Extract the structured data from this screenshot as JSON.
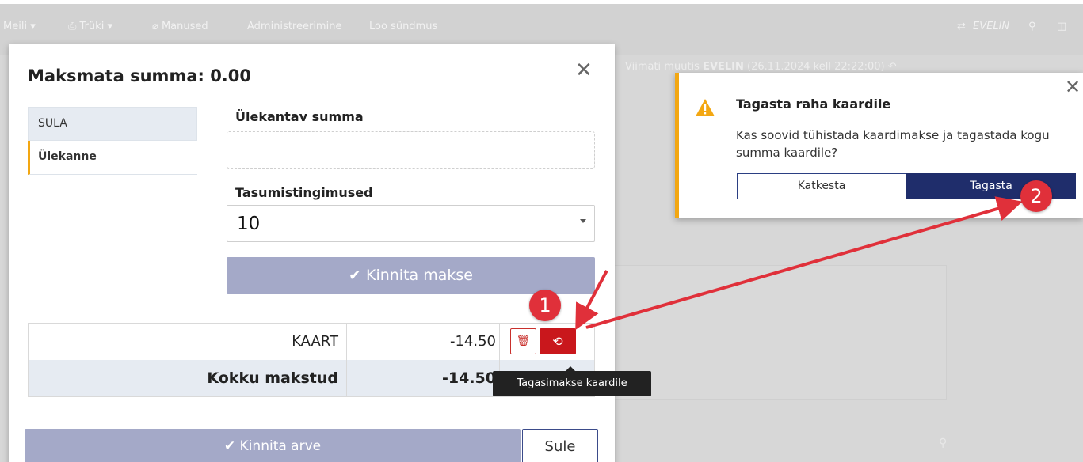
{
  "toolbar": {
    "mail_label": "Meili",
    "print_label": "Trüki",
    "attachments_label": "Manused",
    "admin_label": "Administreerimine",
    "create_event_label": "Loo sündmus",
    "user_name": "EVELIN"
  },
  "background": {
    "modified_prefix": "Viimati muutis",
    "modified_user": "EVELIN",
    "modified_time": "(26.11.2024 kell 22:22:00)"
  },
  "modal": {
    "title": "Maksmata summa: 0.00",
    "tabs": [
      {
        "label": "SULA"
      },
      {
        "label": "Ülekanne"
      }
    ],
    "transfer_amount_label": "Ülekantav summa",
    "payment_terms_label": "Tasumistingimused",
    "payment_terms_value": "10",
    "confirm_payment_label": "Kinnita makse",
    "payments": [
      {
        "name": "KAART",
        "amount": "-14.50"
      }
    ],
    "total_label": "Kokku makstud",
    "total_amount": "-14.50",
    "refund_tooltip": "Tagasimakse kaardile",
    "confirm_invoice_label": "Kinnita arve",
    "close_label": "Sule"
  },
  "popup": {
    "title": "Tagasta raha kaardile",
    "message": "Kas soovid tühistada kaardimakse ja tagastada kogu summa kaardile?",
    "cancel_label": "Katkesta",
    "confirm_label": "Tagasta"
  },
  "annotations": {
    "step1": "1",
    "step2": "2",
    "arrow_color": "#e0303a"
  },
  "colors": {
    "accent": "#f3a712",
    "primary": "#1f2d6b",
    "danger": "#c9171c",
    "disabled": "#a4a9c8"
  }
}
